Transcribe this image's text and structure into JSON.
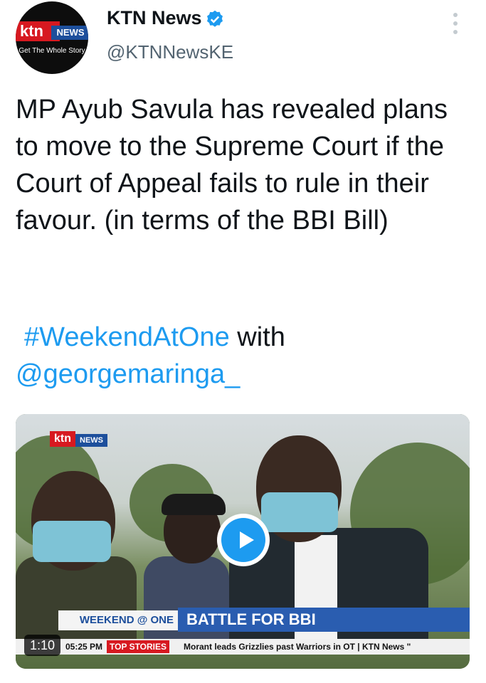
{
  "account": {
    "display_name": "KTN News",
    "handle": "@KTNNewsKE",
    "verified_icon": "verified-badge-icon",
    "avatar": {
      "brand_red": "ktn",
      "brand_blue": "NEWS",
      "tagline": "Get The Whole Story"
    }
  },
  "tweet": {
    "text": "MP Ayub Savula has revealed plans to move to the Supreme Court if the Court of Appeal fails to rule in their favour. (in terms of the BBI Bill)",
    "hashtag": "#WeekendAtOne",
    "connector": " with",
    "mention": "@georgemaringa_"
  },
  "media": {
    "logo_red": "ktn",
    "logo_blue": "NEWS",
    "program": "WEEKEND @ ONE",
    "headline": "BATTLE FOR BBI",
    "ticker_time": "05:25 PM",
    "ticker_label": "TOP STORIES",
    "ticker_text": "Morant leads Grizzlies past Warriors in OT  |  KTN News \"",
    "duration": "1:10"
  },
  "colors": {
    "link": "#1d9bf0",
    "ktn_red": "#d71920",
    "ktn_blue": "#1d4f9c"
  }
}
